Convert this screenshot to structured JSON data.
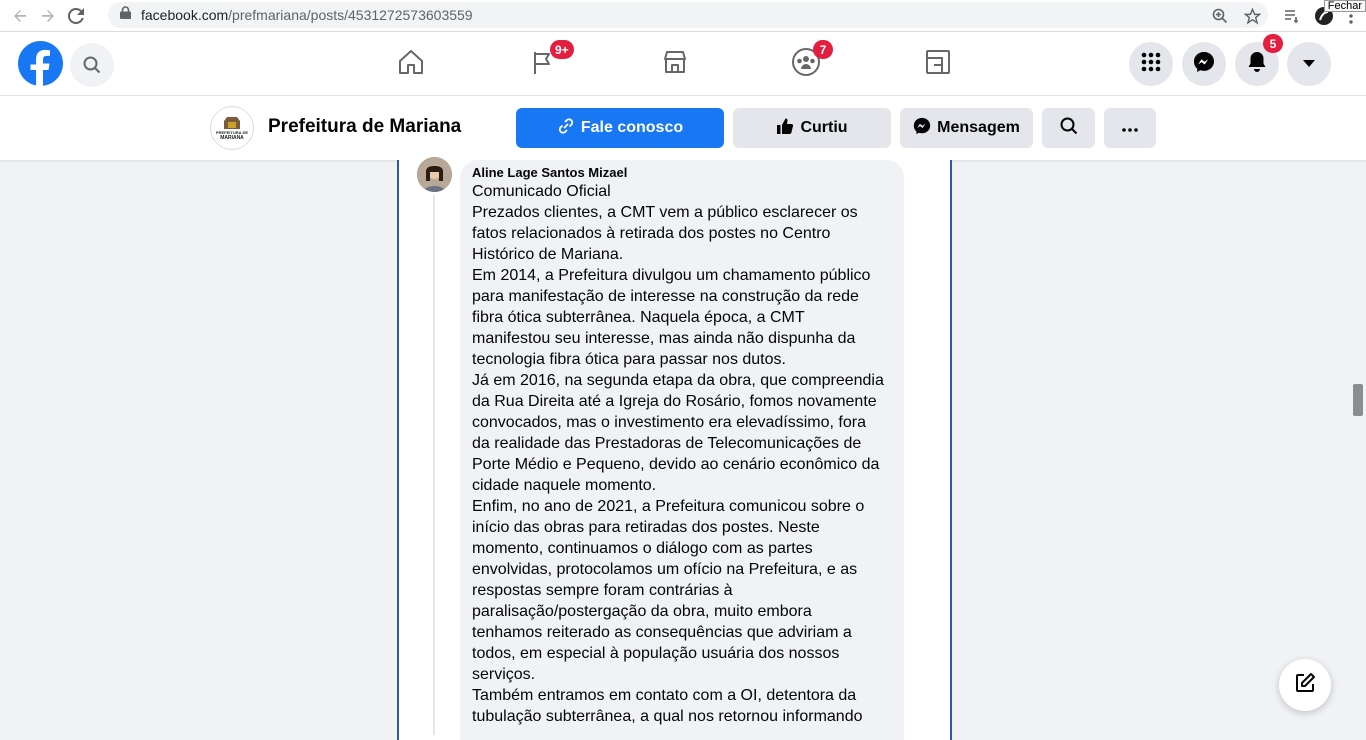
{
  "browser": {
    "url_domain": "facebook.com",
    "url_path": "/prefmariana/posts/4531272573603559",
    "tooltip": "Fechar"
  },
  "nav": {
    "badges": {
      "watch": "9+",
      "groups": "7",
      "notifications": "5"
    }
  },
  "page": {
    "avatar_text_top": "PREFEITURA DE",
    "avatar_text_bottom": "MARIANA",
    "name": "Prefeitura de Mariana",
    "buttons": {
      "contact": "Fale conosco",
      "liked": "Curtiu",
      "message": "Mensagem"
    }
  },
  "comment": {
    "author": "Aline Lage Santos Mizael",
    "lines": [
      "Comunicado Oficial",
      "Prezados clientes, a CMT vem a público esclarecer os",
      "fatos relacionados à retirada dos postes no Centro",
      "Histórico de Mariana.",
      "Em 2014, a Prefeitura divulgou um chamamento público",
      "para manifestação de interesse na construção da rede",
      "fibra ótica subterrânea. Naquela época, a CMT",
      "manifestou seu interesse, mas ainda não dispunha da",
      "tecnologia fibra ótica para passar nos dutos.",
      "Já em 2016, na segunda etapa da obra, que compreendia",
      "da Rua Direita até a Igreja do Rosário, fomos novamente",
      "convocados, mas o investimento era elevadíssimo, fora",
      "da realidade das Prestadoras de Telecomunicações de",
      "Porte Médio e Pequeno, devido ao cenário econômico da",
      "cidade naquele momento.",
      "Enfim, no ano de 2021, a Prefeitura comunicou sobre o",
      "início das obras para retiradas dos postes. Neste",
      "momento, continuamos o diálogo com as partes",
      "envolvidas, protocolamos um ofício na Prefeitura, e as",
      "respostas sempre foram contrárias à",
      "paralisação/postergação da obra, muito embora",
      "tenhamos reiterado as consequências que adviriam a",
      "todos, em especial à população usuária dos nossos",
      "serviços.",
      "Também entramos em contato com a OI, detentora da",
      "tubulação subterrânea, a qual nos retornou informando"
    ]
  }
}
